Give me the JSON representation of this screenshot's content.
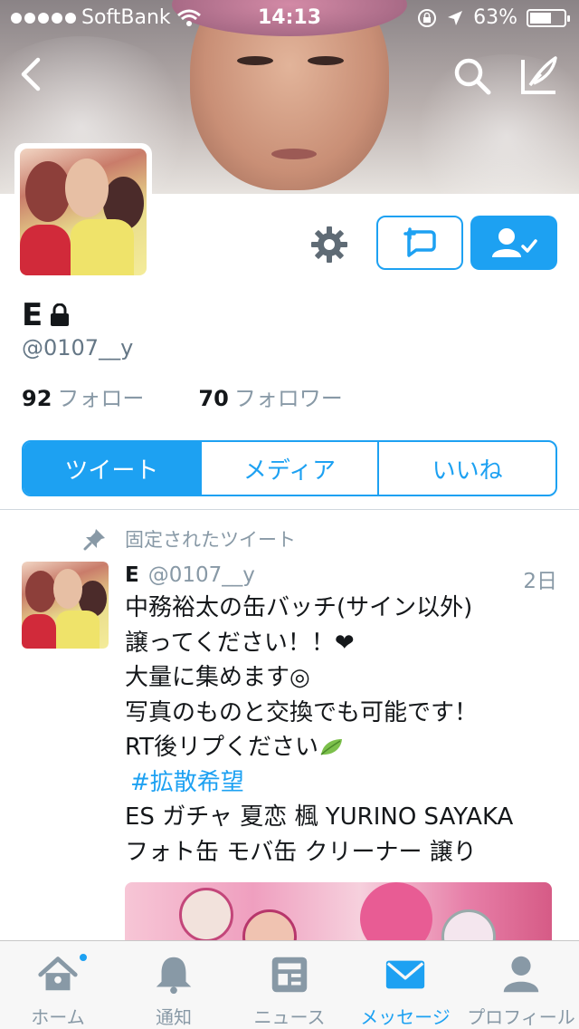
{
  "status_bar": {
    "carrier": "SoftBank",
    "time": "14:13",
    "battery": "63%",
    "battery_level": 0.63
  },
  "profile": {
    "name": "E",
    "handle": "@0107__y",
    "following_count": "92",
    "following_label": "フォロー",
    "followers_count": "70",
    "followers_label": "フォロワー"
  },
  "tabs": [
    "ツイート",
    "メディア",
    "いいね"
  ],
  "tweet": {
    "pinned_label": "固定されたツイート",
    "name": "E",
    "handle": "@0107__y",
    "date": "2日",
    "lines": [
      "中務裕太の缶バッチ(サイン以外)",
      "譲ってください！！❤",
      "大量に集めます◎",
      "写真のものと交換でも可能です！",
      "RT後リプください"
    ],
    "hashtag": "#拡散希望",
    "lines_after": [
      "ES ガチャ 夏恋 楓 YURINO SAYAKA",
      "フォト缶 モバ缶 クリーナー 譲り"
    ]
  },
  "tab_bar": {
    "items": [
      "ホーム",
      "通知",
      "ニュース",
      "メッセージ",
      "プロフィール"
    ],
    "active": "メッセージ"
  },
  "colors": {
    "accent": "#1da1f2",
    "muted": "#8899a6",
    "text": "#14171a"
  },
  "icons": {
    "back": "chevron-left-icon",
    "search": "search-icon",
    "compose": "compose-icon",
    "settings": "gear-icon",
    "direct_message": "dm-add-icon",
    "following": "user-check-icon",
    "lock": "lock-icon",
    "pin": "pin-icon",
    "home": "home-icon",
    "notifications": "bell-icon",
    "news": "news-icon",
    "messages": "envelope-icon",
    "profile": "person-icon"
  }
}
